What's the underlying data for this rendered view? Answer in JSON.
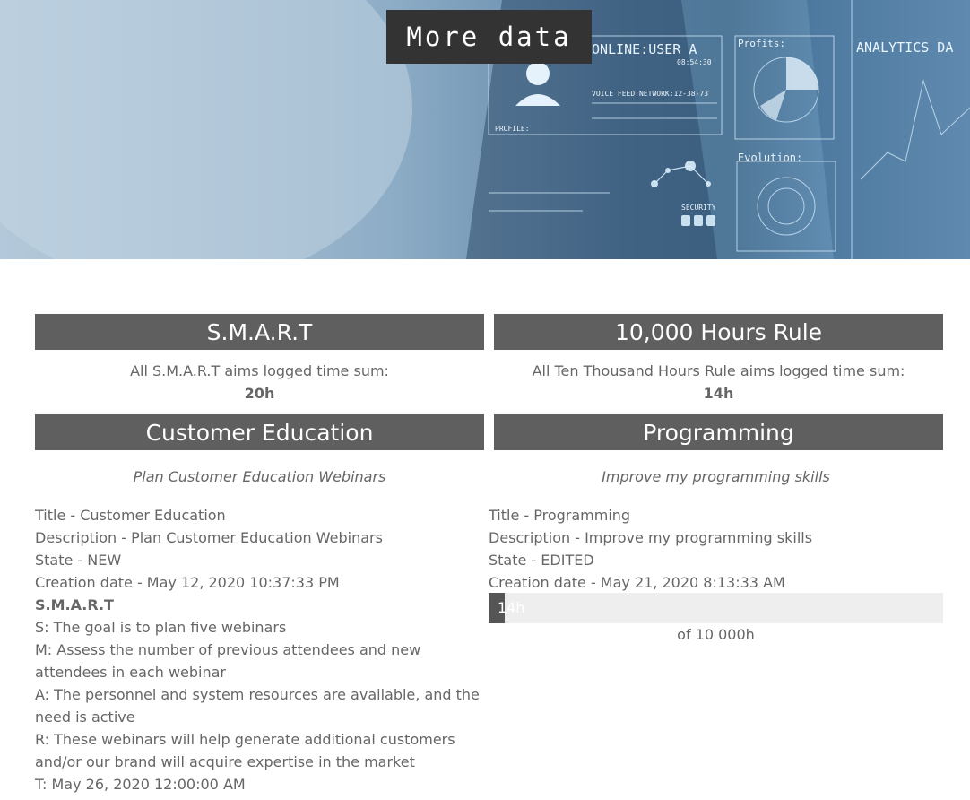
{
  "hero": {
    "button_label": "More data",
    "panel_online": "ONLINE:USER A",
    "panel_time": "08:54:30",
    "panel_voice": "VOICE FEED:NETWORK:12-38-73",
    "panel_profile": "PROFILE:",
    "panel_security": "SECURITY",
    "panel_profits": "Profits:",
    "panel_evolution": "Evolution:",
    "panel_analytics": "ANALYTICS DA"
  },
  "summary": [
    {
      "title": "S.M.A.R.T",
      "text": "All S.M.A.R.T aims logged time sum:",
      "value": "20h"
    },
    {
      "title": "10,000 Hours Rule",
      "text": "All Ten Thousand Hours Rule aims logged time sum:",
      "value": "14h"
    }
  ],
  "goals": [
    {
      "title": "Customer Education",
      "subtitle": "Plan Customer Education Webinars",
      "title_line": "Title - Customer Education",
      "description_line": "Description - Plan Customer Education Webinars",
      "state_line": "State - NEW",
      "creation_line": "Creation date - May 12, 2020 10:37:33 PM",
      "method_label": "S.M.A.R.T",
      "s_line": "S: The goal is to plan five webinars",
      "m_line": "M: Assess the number of previous attendees and new attendees in each webinar",
      "a_line": "A: The personnel and system resources are available, and the need is active",
      "r_line": "R: These webinars will help generate additional customers and/or our brand will acquire expertise in the market",
      "t_line": "T: May 26, 2020 12:00:00 AM"
    },
    {
      "title": "Programming",
      "subtitle": "Improve my programming skills",
      "title_line": "Title - Programming",
      "description_line": "Description - Improve my programming skills",
      "state_line": "State - EDITED",
      "creation_line": "Creation date - May 21, 2020 8:13:33 AM",
      "progress_label": "14h",
      "progress_fraction": 0.0014,
      "progress_of": "of 10 000h"
    }
  ]
}
